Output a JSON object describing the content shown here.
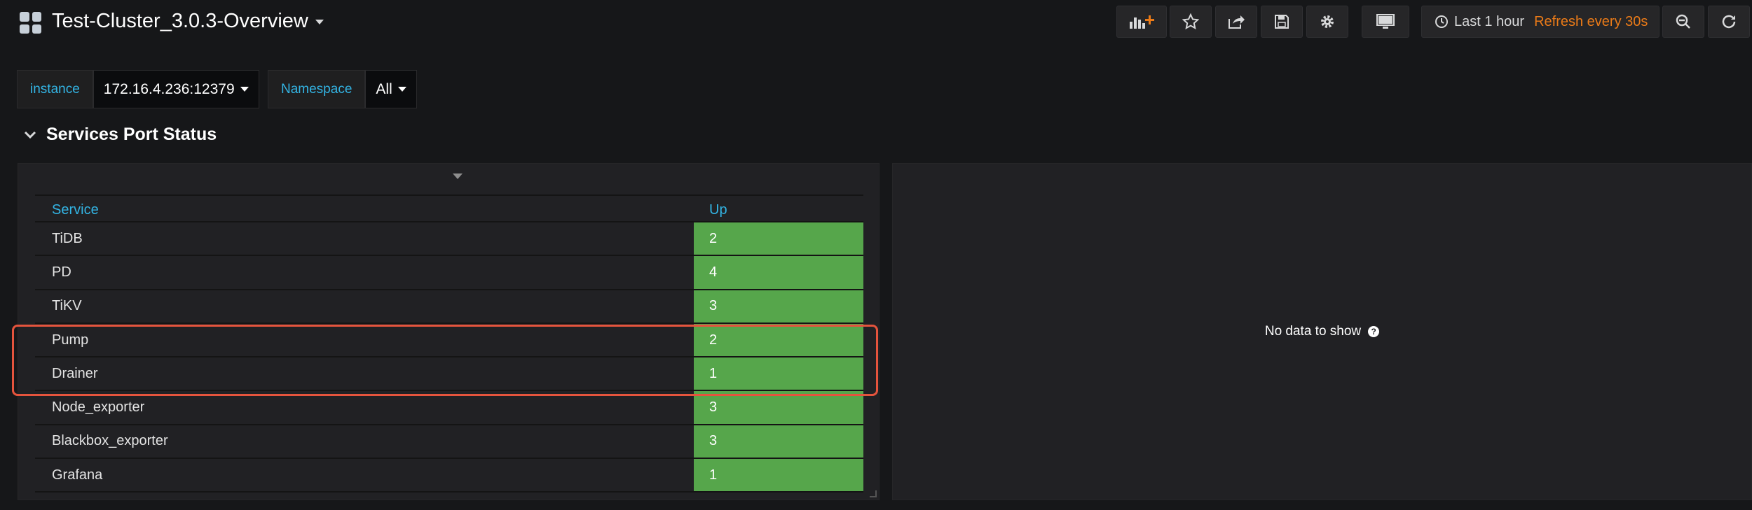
{
  "dashboard": {
    "title": "Test-Cluster_3.0.3-Overview"
  },
  "toolbar": {
    "add_panel_icon": "add-panel-icon",
    "star_icon": "star-icon",
    "share_icon": "share-icon",
    "save_icon": "save-icon",
    "settings_icon": "gear-icon",
    "tv_icon": "monitor-icon",
    "time_range": "Last 1 hour",
    "refresh": "Refresh every 30s",
    "zoom_icon": "zoom-out-icon",
    "refresh_icon": "refresh-icon"
  },
  "variables": [
    {
      "label": "instance",
      "value": "172.16.4.236:12379"
    },
    {
      "label": "Namespace",
      "value": "All"
    }
  ],
  "row": {
    "title": "Services Port Status"
  },
  "table": {
    "headers": [
      "Service",
      "Up"
    ],
    "rows": [
      {
        "service": "TiDB",
        "up": "2"
      },
      {
        "service": "PD",
        "up": "4"
      },
      {
        "service": "TiKV",
        "up": "3"
      },
      {
        "service": "Pump",
        "up": "2"
      },
      {
        "service": "Drainer",
        "up": "1"
      },
      {
        "service": "Node_exporter",
        "up": "3"
      },
      {
        "service": "Blackbox_exporter",
        "up": "3"
      },
      {
        "service": "Grafana",
        "up": "1"
      }
    ]
  },
  "right_panel": {
    "message": "No data to show"
  },
  "colors": {
    "up_cell": "#56a64b",
    "header_text": "#33b5e5",
    "refresh_text": "#eb7b18",
    "highlight": "#e5543d"
  }
}
